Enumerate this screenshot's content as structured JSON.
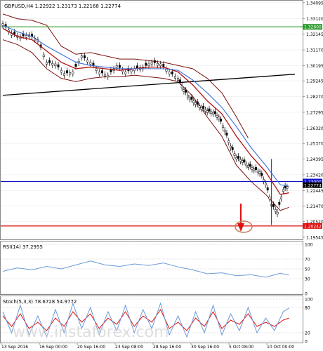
{
  "symbol_line": "GBPUSD,H4  1.22922 1.23173 1.22168 1.22774",
  "watermark": "www.instaforex.com",
  "colors": {
    "candle": "#000000",
    "ma_red": "#b01010",
    "ma_blue": "#3a6fd8",
    "bands": "#7a1010",
    "trendline": "#000000",
    "level_green": "#2a9a2a",
    "level_blue": "#1010cc",
    "level_red": "#dd1111",
    "arrow": "#dd1111",
    "circle": "#c08060",
    "rsi_line": "#6a9ad8",
    "stoch_main": "#6a9ad8",
    "stoch_signal": "#dd1111",
    "grid": "#c8c8c8"
  },
  "chart_data": [
    {
      "type": "line",
      "title": "GBPUSD,H4  1.22922 1.23173 1.22168 1.22774",
      "ylim": [
        1.1954,
        1.3409
      ],
      "y_ticks": [
        "1.34095",
        "1.33120",
        "1.32145",
        "1.31170",
        "1.30195",
        "1.29245",
        "1.28270",
        "1.27295",
        "1.26320",
        "1.25370",
        "1.24395",
        "1.23420",
        "1.22445",
        "1.21470",
        "1.20520",
        "1.19545"
      ],
      "x_ticks": [
        "13 Sep 2016",
        "16 Sep 00:00",
        "20 Sep 16:00",
        "23 Sep 08:00",
        "28 Sep 16:00",
        "30 Sep 16:00",
        "5 Oct 08:00",
        "10 Oct 00:00"
      ],
      "levels": [
        {
          "label": "1.32600",
          "value": 1.326,
          "color": "#2a9a2a"
        },
        {
          "label": "1.23000",
          "value": 1.23,
          "color": "#1010cc"
        },
        {
          "label": "1.22774",
          "value": 1.22774,
          "color": "#000000"
        },
        {
          "label": "1.20242",
          "value": 1.20242,
          "color": "#dd1111"
        }
      ],
      "trendline": {
        "x": [
          0,
          100
        ],
        "y": [
          1.2835,
          1.2966
        ]
      },
      "series": [
        {
          "values_x": [
            0,
            3,
            6,
            9,
            12,
            15,
            18,
            21,
            24,
            27,
            30,
            33,
            36,
            39,
            42,
            45,
            48,
            51,
            54,
            57,
            60,
            62,
            64,
            66,
            68,
            70,
            72,
            74,
            76,
            78,
            80,
            82,
            84,
            86,
            88,
            90,
            92,
            94,
            96,
            98
          ],
          "values": [
            1.328,
            1.322,
            1.32,
            1.321,
            1.318,
            1.304,
            1.303,
            1.297,
            1.298,
            1.308,
            1.304,
            1.298,
            1.296,
            1.302,
            1.298,
            1.3,
            1.301,
            1.304,
            1.303,
            1.298,
            1.294,
            1.287,
            1.282,
            1.279,
            1.276,
            1.274,
            1.273,
            1.27,
            1.262,
            1.252,
            1.245,
            1.243,
            1.24,
            1.238,
            1.236,
            1.229,
            1.216,
            1.211,
            1.225,
            1.2278
          ]
        },
        {
          "values_x": [
            0,
            5,
            10,
            15,
            20,
            25,
            30,
            35,
            40,
            45,
            50,
            55,
            60,
            65,
            70,
            75,
            80,
            85,
            90,
            95,
            98
          ],
          "values": [
            1.325,
            1.32,
            1.318,
            1.311,
            1.304,
            1.3,
            1.301,
            1.3,
            1.299,
            1.3,
            1.301,
            1.301,
            1.298,
            1.29,
            1.28,
            1.272,
            1.258,
            1.246,
            1.236,
            1.222,
            1.223
          ]
        },
        {
          "values_x": [
            0,
            5,
            10,
            15,
            20,
            25,
            30,
            35,
            40,
            45,
            50,
            55,
            60,
            65,
            70,
            75,
            80,
            85,
            90,
            95,
            98
          ],
          "values": [
            1.327,
            1.323,
            1.32,
            1.314,
            1.309,
            1.304,
            1.302,
            1.301,
            1.3,
            1.3,
            1.3,
            1.3,
            1.299,
            1.293,
            1.285,
            1.276,
            1.264,
            1.251,
            1.24,
            1.228,
            1.227
          ]
        },
        {
          "values_x": [
            0,
            5,
            10,
            15,
            20,
            25,
            30,
            35,
            40,
            45,
            50,
            55,
            60,
            65,
            70,
            75,
            80,
            84
          ],
          "values": [
            1.334,
            1.331,
            1.33,
            1.327,
            1.314,
            1.309,
            1.31,
            1.308,
            1.306,
            1.306,
            1.305,
            1.304,
            1.302,
            1.3,
            1.294,
            1.285,
            1.27,
            1.257
          ]
        },
        {
          "values_x": [
            0,
            5,
            10,
            15,
            20,
            25,
            30,
            35,
            40,
            45,
            50,
            55,
            60,
            65,
            70,
            75,
            80,
            85,
            90,
            95,
            98
          ],
          "values": [
            1.318,
            1.315,
            1.31,
            1.3,
            1.294,
            1.292,
            1.294,
            1.295,
            1.295,
            1.296,
            1.295,
            1.294,
            1.292,
            1.283,
            1.27,
            1.258,
            1.24,
            1.23,
            1.222,
            1.212,
            1.214
          ]
        }
      ]
    },
    {
      "type": "line",
      "title": "RSI(14) 37.2955",
      "ylim": [
        0,
        100
      ],
      "y_ticks": [
        "100",
        "70",
        "50",
        "30",
        "0"
      ],
      "x": [
        0,
        5,
        10,
        15,
        20,
        25,
        30,
        35,
        40,
        45,
        50,
        55,
        60,
        65,
        70,
        75,
        80,
        85,
        90,
        95,
        98
      ],
      "values": [
        45,
        52,
        48,
        55,
        50,
        58,
        66,
        58,
        55,
        60,
        57,
        62,
        54,
        48,
        40,
        42,
        36,
        38,
        33,
        41,
        37.3
      ]
    },
    {
      "type": "line",
      "title": "Stoch(5,3,3) 78.6728 54.9772",
      "ylim": [
        0,
        100
      ],
      "y_ticks": [
        "100",
        "80",
        "20",
        "0"
      ],
      "x": [
        0,
        3,
        6,
        9,
        12,
        15,
        18,
        21,
        24,
        27,
        30,
        33,
        36,
        39,
        42,
        45,
        48,
        51,
        54,
        57,
        60,
        63,
        66,
        69,
        72,
        75,
        78,
        81,
        84,
        87,
        90,
        93,
        96,
        98
      ],
      "series": [
        {
          "name": "main",
          "values": [
            70,
            20,
            85,
            15,
            60,
            10,
            75,
            20,
            90,
            30,
            80,
            15,
            70,
            25,
            85,
            20,
            75,
            30,
            90,
            15,
            60,
            10,
            70,
            20,
            85,
            15,
            65,
            25,
            80,
            20,
            55,
            25,
            70,
            78.7
          ]
        },
        {
          "name": "signal",
          "values": [
            60,
            35,
            65,
            30,
            45,
            25,
            55,
            35,
            70,
            45,
            65,
            30,
            55,
            40,
            70,
            35,
            60,
            45,
            75,
            30,
            45,
            25,
            55,
            35,
            70,
            30,
            50,
            40,
            65,
            35,
            45,
            35,
            50,
            55.0
          ]
        }
      ]
    }
  ]
}
